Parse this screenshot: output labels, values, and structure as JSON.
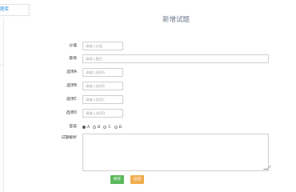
{
  "tab": {
    "label": "题库"
  },
  "page": {
    "title": "新增试题"
  },
  "form": {
    "score": {
      "label": "分值",
      "placeholder": "请输入分值",
      "value": ""
    },
    "question": {
      "label": "题目",
      "placeholder": "请输入题目",
      "value": ""
    },
    "optionA": {
      "label": "选项A",
      "placeholder": "请输入选项A",
      "value": ""
    },
    "optionB": {
      "label": "选项B",
      "placeholder": "请输入选项B",
      "value": ""
    },
    "optionC": {
      "label": "选项C",
      "placeholder": "请输入选项C",
      "value": ""
    },
    "optionD": {
      "label": "选项D",
      "placeholder": "请输入选项D",
      "value": ""
    },
    "answer": {
      "label": "答案",
      "options": [
        "A",
        "B",
        "C",
        "D"
      ],
      "selected": "A"
    },
    "analysis": {
      "label": "试题解析",
      "value": ""
    }
  },
  "buttons": {
    "save": "保存",
    "back": "返回"
  }
}
